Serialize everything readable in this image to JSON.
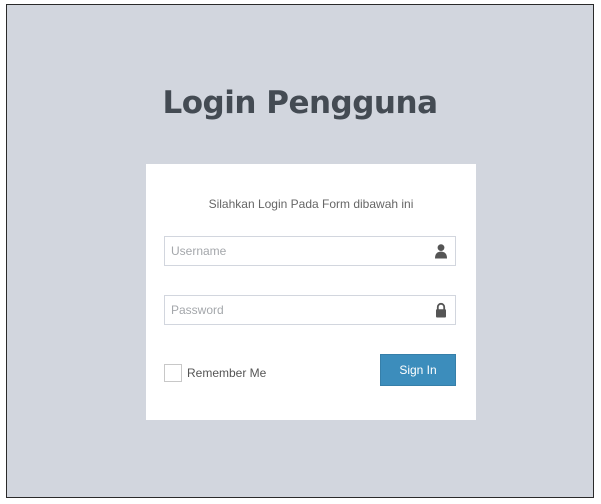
{
  "page": {
    "title": "Login Pengguna"
  },
  "login_box": {
    "message": "Silahkan Login Pada Form dibawah ini",
    "username": {
      "placeholder": "Username",
      "value": "",
      "icon": "user-icon"
    },
    "password": {
      "placeholder": "Password",
      "value": "",
      "icon": "lock-icon"
    },
    "remember_me_label": "Remember Me",
    "remember_me_checked": false,
    "sign_in_label": "Sign In"
  },
  "colors": {
    "background": "#d2d6de",
    "box": "#ffffff",
    "primary": "#3c8dbc",
    "icon": "#555555",
    "title": "#444b53"
  }
}
